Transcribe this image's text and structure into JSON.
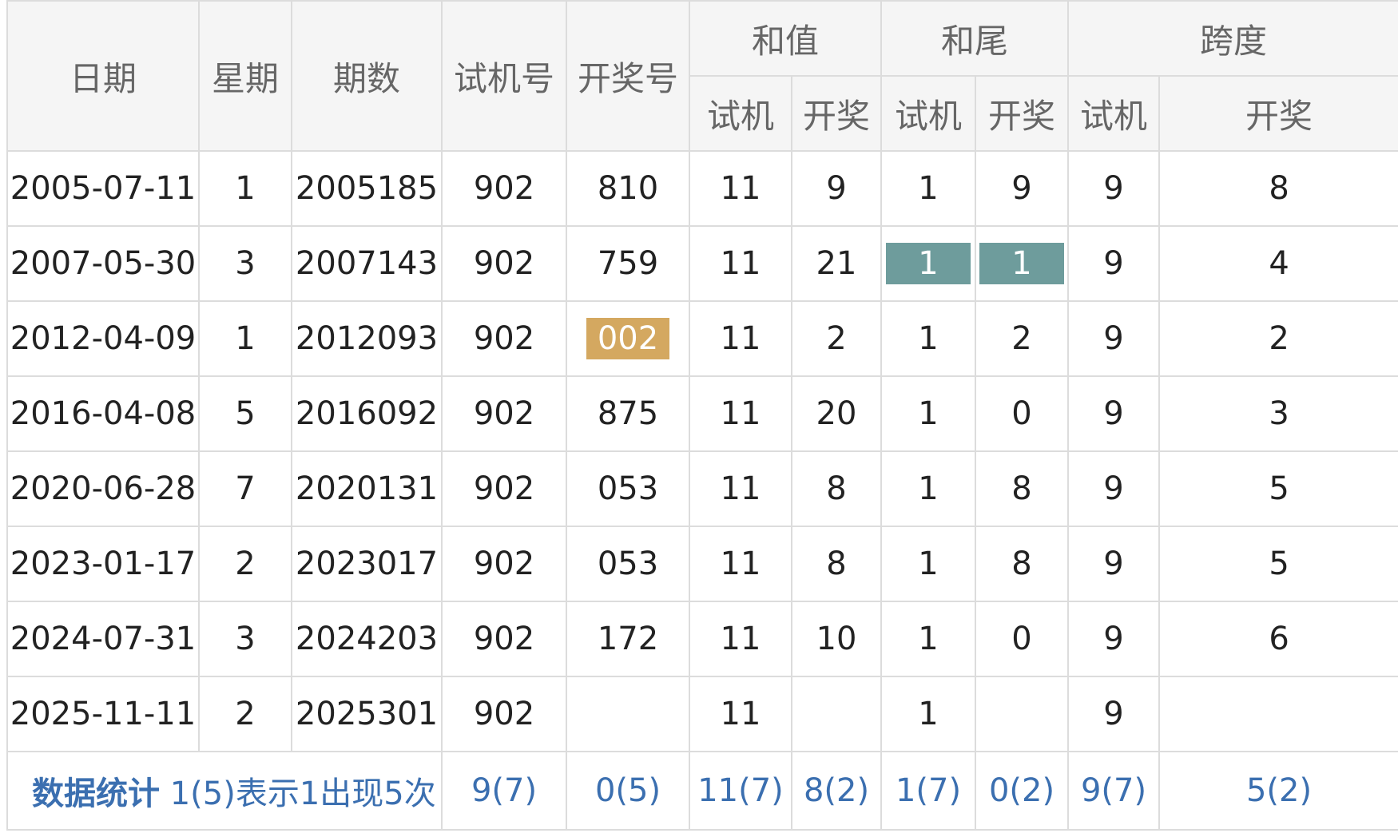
{
  "headers": {
    "date": "日期",
    "weekday": "星期",
    "issue": "期数",
    "trial": "试机号",
    "draw": "开奖号",
    "sum": "和值",
    "tail": "和尾",
    "span": "跨度",
    "sub_trial": "试机",
    "sub_draw": "开奖"
  },
  "rows": [
    {
      "date": "2005-07-11",
      "weekday": "1",
      "issue": "2005185",
      "trial": "902",
      "draw": "810",
      "sum_trial": "11",
      "sum_draw": "9",
      "tail_trial": "1",
      "tail_draw": "9",
      "span_trial": "9",
      "span_draw": "8"
    },
    {
      "date": "2007-05-30",
      "weekday": "3",
      "issue": "2007143",
      "trial": "902",
      "draw": "759",
      "sum_trial": "11",
      "sum_draw": "21",
      "tail_trial": "1",
      "tail_draw": "1",
      "span_trial": "9",
      "span_draw": "4"
    },
    {
      "date": "2012-04-09",
      "weekday": "1",
      "issue": "2012093",
      "trial": "902",
      "draw": "002",
      "sum_trial": "11",
      "sum_draw": "2",
      "tail_trial": "1",
      "tail_draw": "2",
      "span_trial": "9",
      "span_draw": "2"
    },
    {
      "date": "2016-04-08",
      "weekday": "5",
      "issue": "2016092",
      "trial": "902",
      "draw": "875",
      "sum_trial": "11",
      "sum_draw": "20",
      "tail_trial": "1",
      "tail_draw": "0",
      "span_trial": "9",
      "span_draw": "3"
    },
    {
      "date": "2020-06-28",
      "weekday": "7",
      "issue": "2020131",
      "trial": "902",
      "draw": "053",
      "sum_trial": "11",
      "sum_draw": "8",
      "tail_trial": "1",
      "tail_draw": "8",
      "span_trial": "9",
      "span_draw": "5"
    },
    {
      "date": "2023-01-17",
      "weekday": "2",
      "issue": "2023017",
      "trial": "902",
      "draw": "053",
      "sum_trial": "11",
      "sum_draw": "8",
      "tail_trial": "1",
      "tail_draw": "8",
      "span_trial": "9",
      "span_draw": "5"
    },
    {
      "date": "2024-07-31",
      "weekday": "3",
      "issue": "2024203",
      "trial": "902",
      "draw": "172",
      "sum_trial": "11",
      "sum_draw": "10",
      "tail_trial": "1",
      "tail_draw": "0",
      "span_trial": "9",
      "span_draw": "6"
    },
    {
      "date": "2025-11-11",
      "weekday": "2",
      "issue": "2025301",
      "trial": "902",
      "draw": "",
      "sum_trial": "11",
      "sum_draw": "",
      "tail_trial": "1",
      "tail_draw": "",
      "span_trial": "9",
      "span_draw": ""
    }
  ],
  "stats": {
    "title": "数据统计",
    "desc": "1(5)表示1出现5次",
    "trial": "9(7)",
    "draw": "0(5)",
    "sum_trial": "11(7)",
    "sum_draw": "8(2)",
    "tail_trial": "1(7)",
    "tail_draw": "0(2)",
    "span_trial": "9(7)",
    "span_draw": "5(2)"
  },
  "colors": {
    "draw_text": "#c0272d",
    "highlight_gold": "#d4a860",
    "highlight_teal": "#6e9c9c",
    "stats_text": "#3b6fb0"
  }
}
